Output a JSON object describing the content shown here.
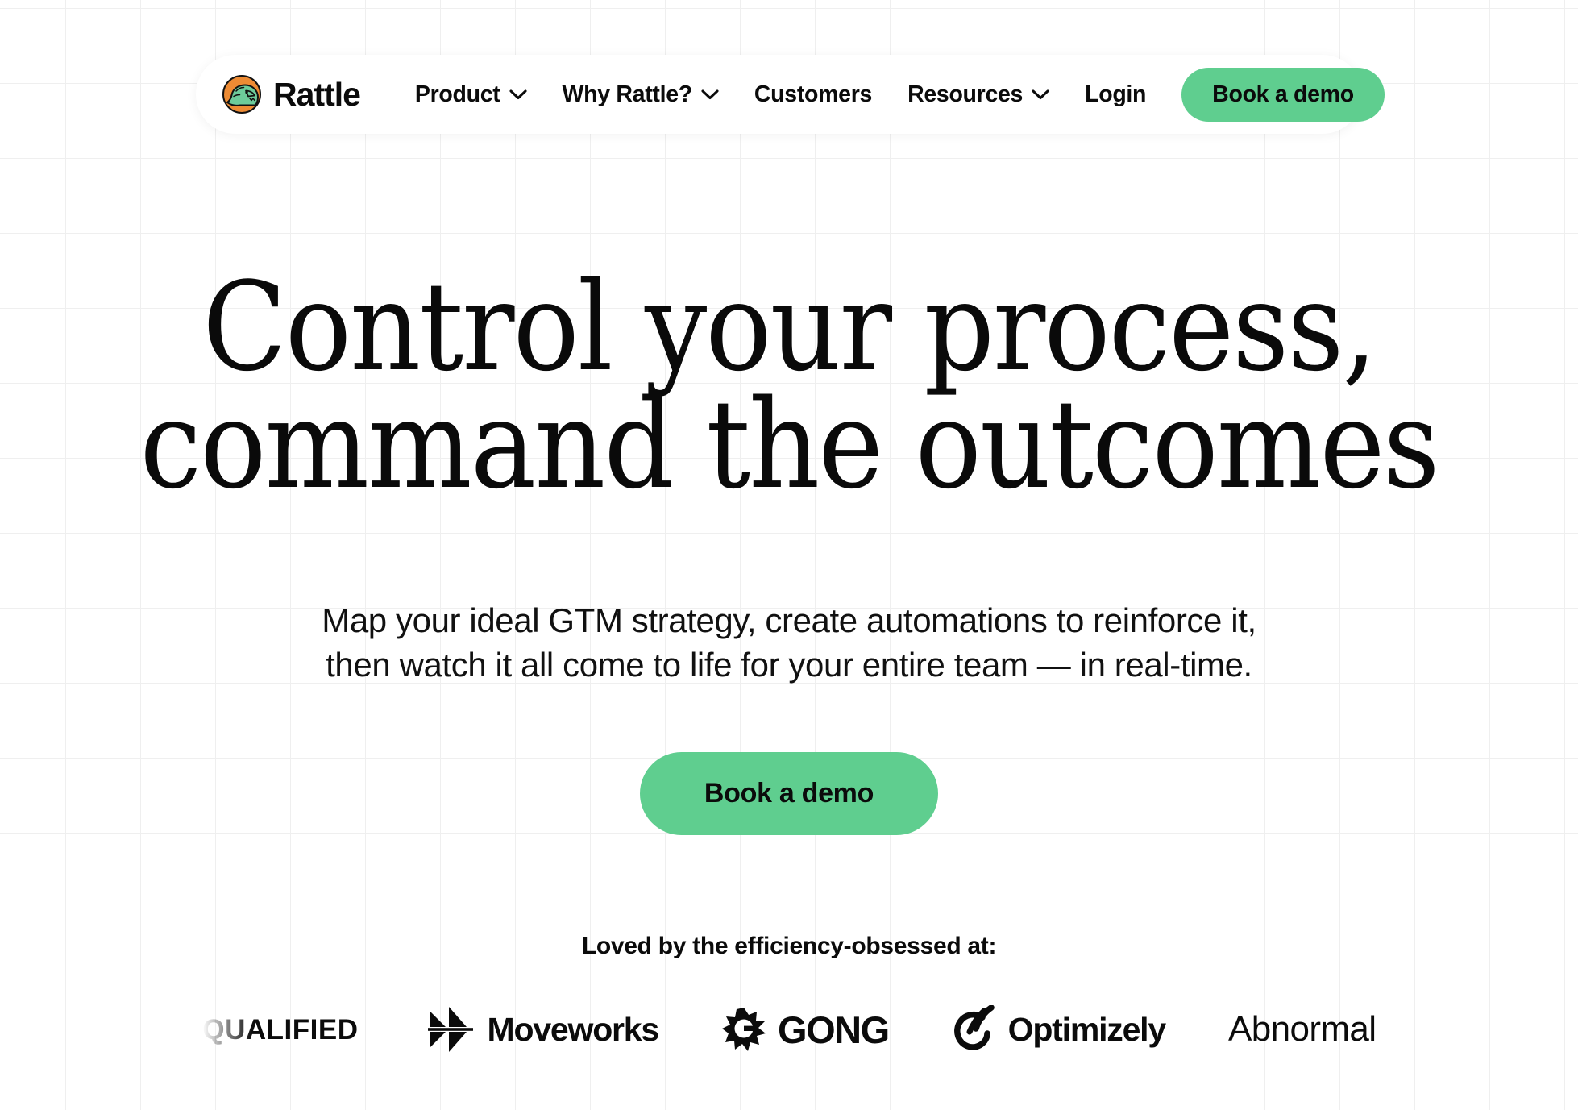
{
  "page": {
    "background_color": "#ffffff",
    "grid_line_color": "#efefef",
    "accent_green": "#5FCE8F",
    "logo_orange": "#ED8B34",
    "logo_green": "#6DCB9A",
    "text_color": "#0a0a0a"
  },
  "nav": {
    "brand_name": "Rattle",
    "brand_icon": "rattle-dinosaur-logo",
    "items": [
      {
        "label": "Product",
        "has_dropdown": true,
        "icon": "chevron-down-icon"
      },
      {
        "label": "Why Rattle?",
        "has_dropdown": true,
        "icon": "chevron-down-icon"
      },
      {
        "label": "Customers",
        "has_dropdown": false
      },
      {
        "label": "Resources",
        "has_dropdown": true,
        "icon": "chevron-down-icon"
      },
      {
        "label": "Login",
        "has_dropdown": false
      }
    ],
    "cta_label": "Book a demo"
  },
  "hero": {
    "headline_line_1": "Control your process,",
    "headline_line_2": "command the outcomes",
    "subheadline_line_1": "Map your ideal GTM strategy, create automations to reinforce it,",
    "subheadline_line_2": "then watch it all come to life for your entire team — in real-time.",
    "cta_label": "Book a demo"
  },
  "social_proof": {
    "title": "Loved by the efficiency-obsessed at:",
    "logos": [
      {
        "name": "Qualified",
        "wordmark": "QUALIFIED",
        "icon": null,
        "clipped": true
      },
      {
        "name": "Moveworks",
        "wordmark": "Moveworks",
        "icon": "moveworks-arrow-icon",
        "clipped": false
      },
      {
        "name": "Gong",
        "wordmark": "GONG",
        "icon": "gong-starburst-icon",
        "clipped": false
      },
      {
        "name": "Optimizely",
        "wordmark": "Optimizely",
        "icon": "optimizely-swirl-icon",
        "clipped": false
      },
      {
        "name": "Abnormal",
        "wordmark": "Abnormal",
        "icon": null,
        "clipped": false
      }
    ]
  }
}
